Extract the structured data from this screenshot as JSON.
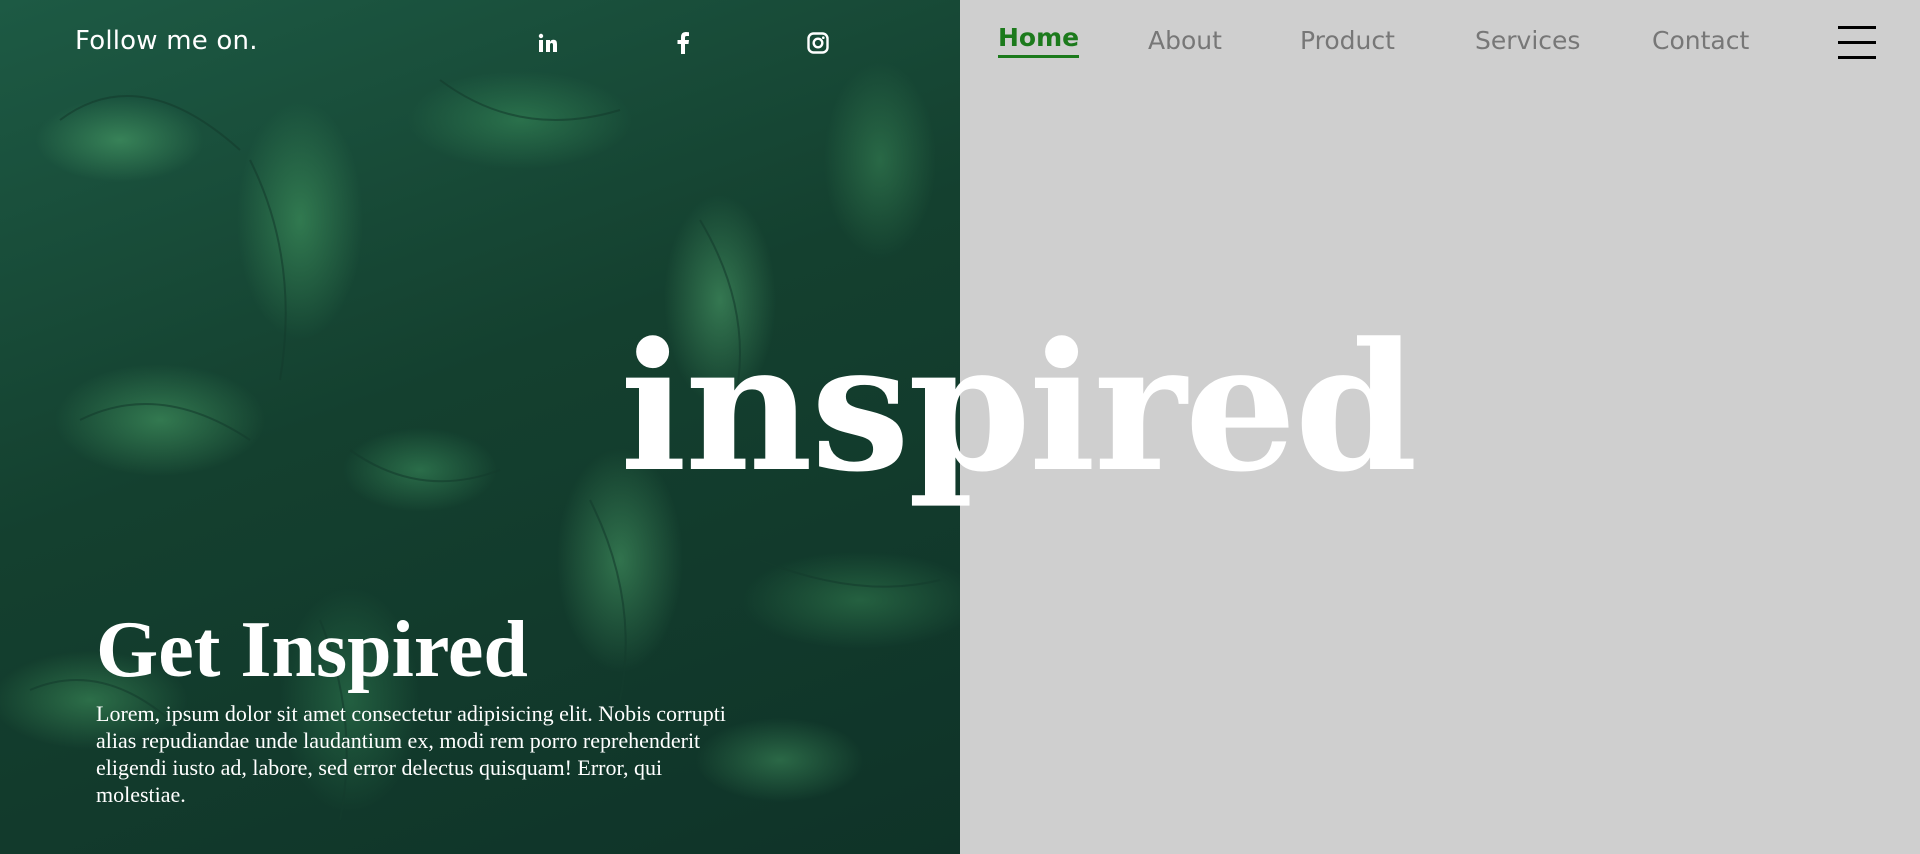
{
  "header": {
    "follow_text": "Follow me on.",
    "social": [
      {
        "name": "linkedin-icon"
      },
      {
        "name": "facebook-icon"
      },
      {
        "name": "instagram-icon"
      }
    ]
  },
  "nav": {
    "items": [
      {
        "label": "Home",
        "active": true
      },
      {
        "label": "About",
        "active": false
      },
      {
        "label": "Product",
        "active": false
      },
      {
        "label": "Services",
        "active": false
      },
      {
        "label": "Contact",
        "active": false
      }
    ],
    "menu_icon": "hamburger-menu-icon"
  },
  "hero": {
    "big_word": "inspired",
    "title": "Get Inspired",
    "body": "Lorem, ipsum dolor sit amet consectetur adipisicing elit. Nobis corrupti alias repudiandae unde laudantium ex, modi rem porro reprehenderit eligendi iusto ad, labore, sed error delectus quisquam! Error, qui molestiae."
  },
  "colors": {
    "accent": "#1c7a1c",
    "nav_text": "#777777",
    "right_bg": "#cfcfcf",
    "left_bg": "#123a2e"
  }
}
